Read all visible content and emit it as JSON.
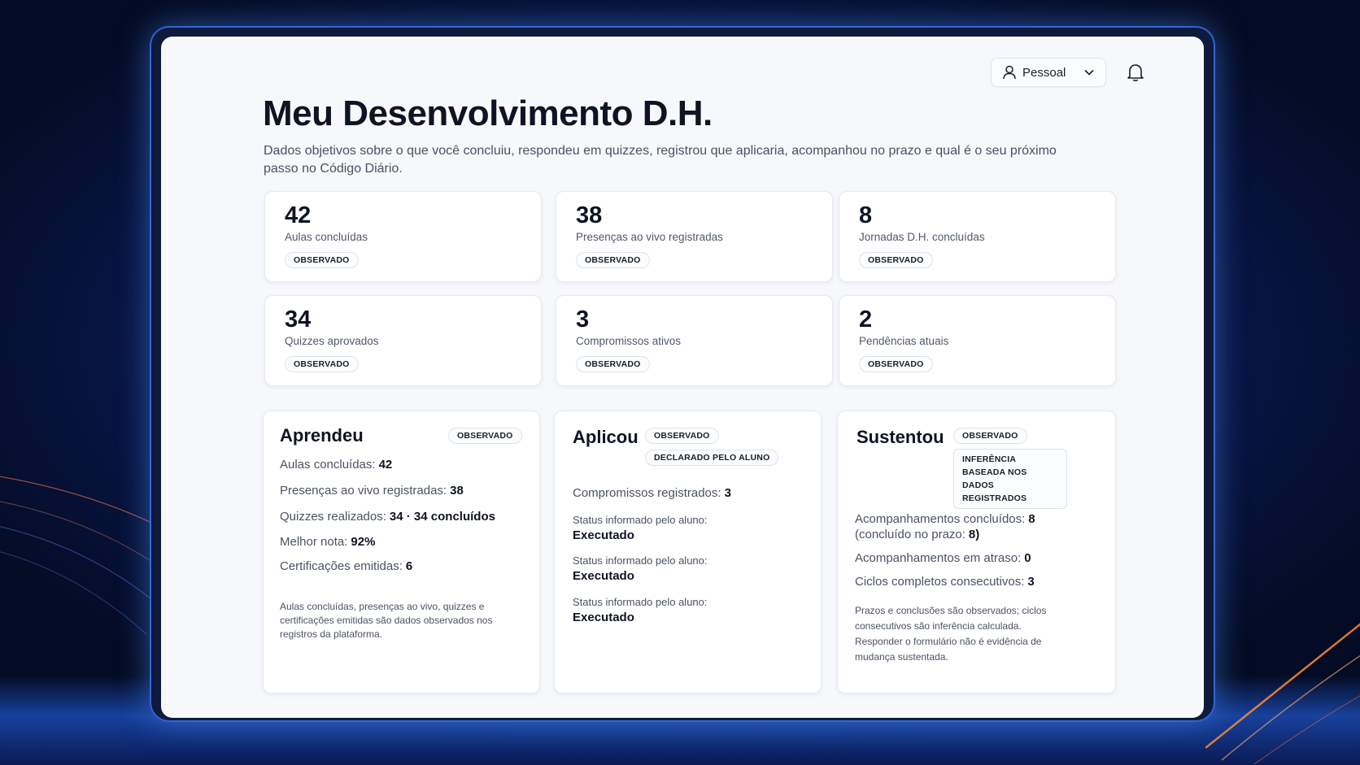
{
  "header": {
    "user_menu_label": "Pessoal",
    "title": "Meu Desenvolvimento D.H.",
    "subtitle": "Dados objetivos sobre o que você concluiu, respondeu em quizzes, registrou que aplicaria, acompanhou no prazo e qual é o seu próximo passo no Código Diário."
  },
  "stats": [
    {
      "value": "42",
      "label": "Aulas concluídas",
      "badge": "OBSERVADO"
    },
    {
      "value": "38",
      "label": "Presenças ao vivo registradas",
      "badge": "OBSERVADO"
    },
    {
      "value": "8",
      "label": "Jornadas D.H. concluídas",
      "badge": "OBSERVADO"
    },
    {
      "value": "34",
      "label": "Quizzes aprovados",
      "badge": "OBSERVADO"
    },
    {
      "value": "3",
      "label": "Compromissos ativos",
      "badge": "OBSERVADO"
    },
    {
      "value": "2",
      "label": "Pendências atuais",
      "badge": "OBSERVADO"
    }
  ],
  "aprendeu": {
    "title": "Aprendeu",
    "badge": "OBSERVADO",
    "rows": [
      {
        "label": "Aulas concluídas:",
        "value": "42"
      },
      {
        "label": "Presenças ao vivo registradas:",
        "value": "38"
      },
      {
        "label": "Quizzes realizados:",
        "value": "34 · 34 concluídos"
      },
      {
        "label": "Melhor nota:",
        "value": "92%"
      },
      {
        "label": "Certificações emitidas:",
        "value": "6"
      }
    ],
    "note": "Aulas concluídas, presenças ao vivo, quizzes e certificações emitidas são dados observados nos registros da plataforma."
  },
  "aplicou": {
    "title": "Aplicou",
    "badge_1": "OBSERVADO",
    "badge_2": "DECLARADO PELO ALUNO",
    "commitments_label": "Compromissos registrados:",
    "commitments_value": "3",
    "status_items": [
      {
        "label": "Status informado pelo aluno:",
        "value": "Executado"
      },
      {
        "label": "Status informado pelo aluno:",
        "value": "Executado"
      },
      {
        "label": "Status informado pelo aluno:",
        "value": "Executado"
      }
    ]
  },
  "sustentou": {
    "title": "Sustentou",
    "badge_1": "OBSERVADO",
    "badge_2": "INFERÊNCIA BASEADA NOS DADOS REGISTRADOS",
    "row_1_label": "Acompanhamentos concluídos:",
    "row_1_value": "8",
    "row_1_cont_label": "(concluído no prazo:",
    "row_1_cont_value": "8)",
    "row_2_label": "Acompanhamentos em atraso:",
    "row_2_value": "0",
    "row_3_label": "Ciclos completos consecutivos:",
    "row_3_value": "3",
    "note": "Prazos e conclusões são observados; ciclos consecutivos são inferência calculada. Responder o formulário não é evidência de mudança sustentada."
  }
}
